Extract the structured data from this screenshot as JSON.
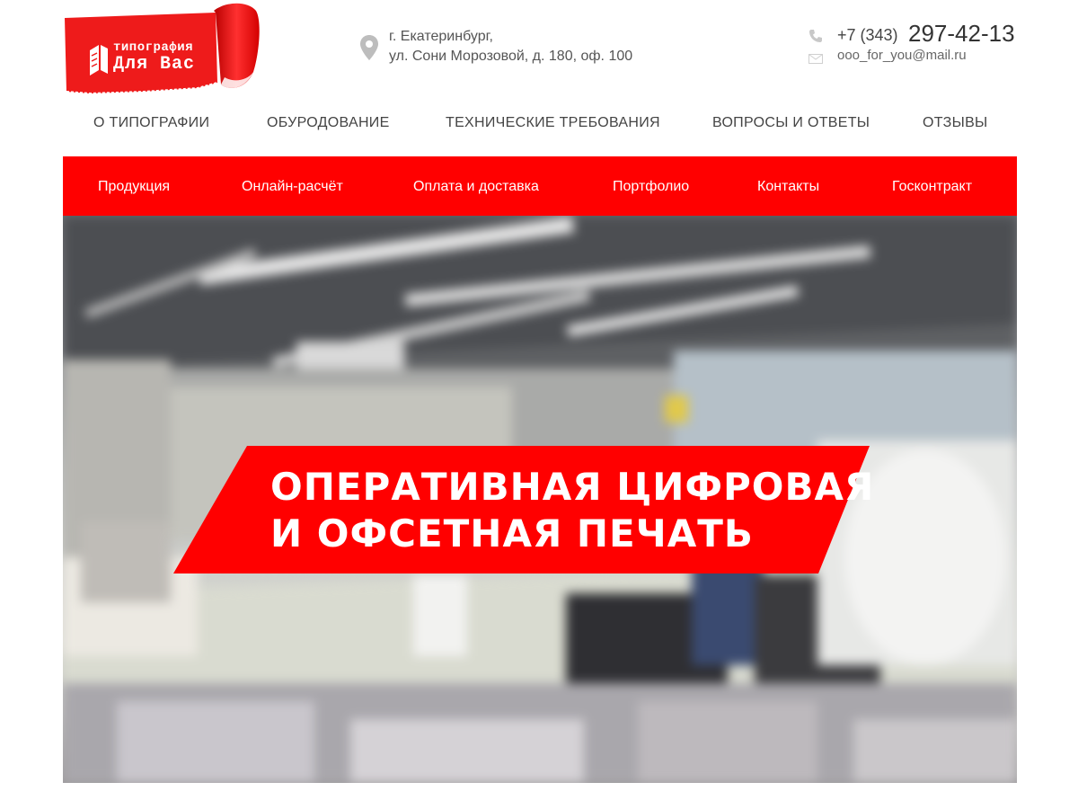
{
  "brand": {
    "line1": "типография",
    "line2": "Для Вас",
    "color": "#ff0000"
  },
  "address": {
    "line1": "г. Екатеринбург,",
    "line2": "ул. Сони Морозовой, д. 180, оф. 100",
    "icon": "map-pin-icon"
  },
  "contacts": {
    "phone_code": "+7 (343)",
    "phone_number": "297-42-13",
    "phone_icon": "phone-icon",
    "email": "ooo_for_you@mail.ru",
    "email_icon": "envelope-icon"
  },
  "top_nav": [
    {
      "label": "О типографии"
    },
    {
      "label": "Обуродование"
    },
    {
      "label": "Технические требования"
    },
    {
      "label": "Вопросы и ответы"
    },
    {
      "label": "Отзывы"
    }
  ],
  "red_nav": [
    {
      "label": "Продукция"
    },
    {
      "label": "Онлайн-расчёт"
    },
    {
      "label": "Оплата и доставка"
    },
    {
      "label": "Портфолио"
    },
    {
      "label": "Контакты"
    },
    {
      "label": "Госконтракт"
    }
  ],
  "hero": {
    "headline_line1": "Оперативная цифровая",
    "headline_line2": "и офсетная печать",
    "accent": "#ff0000"
  }
}
